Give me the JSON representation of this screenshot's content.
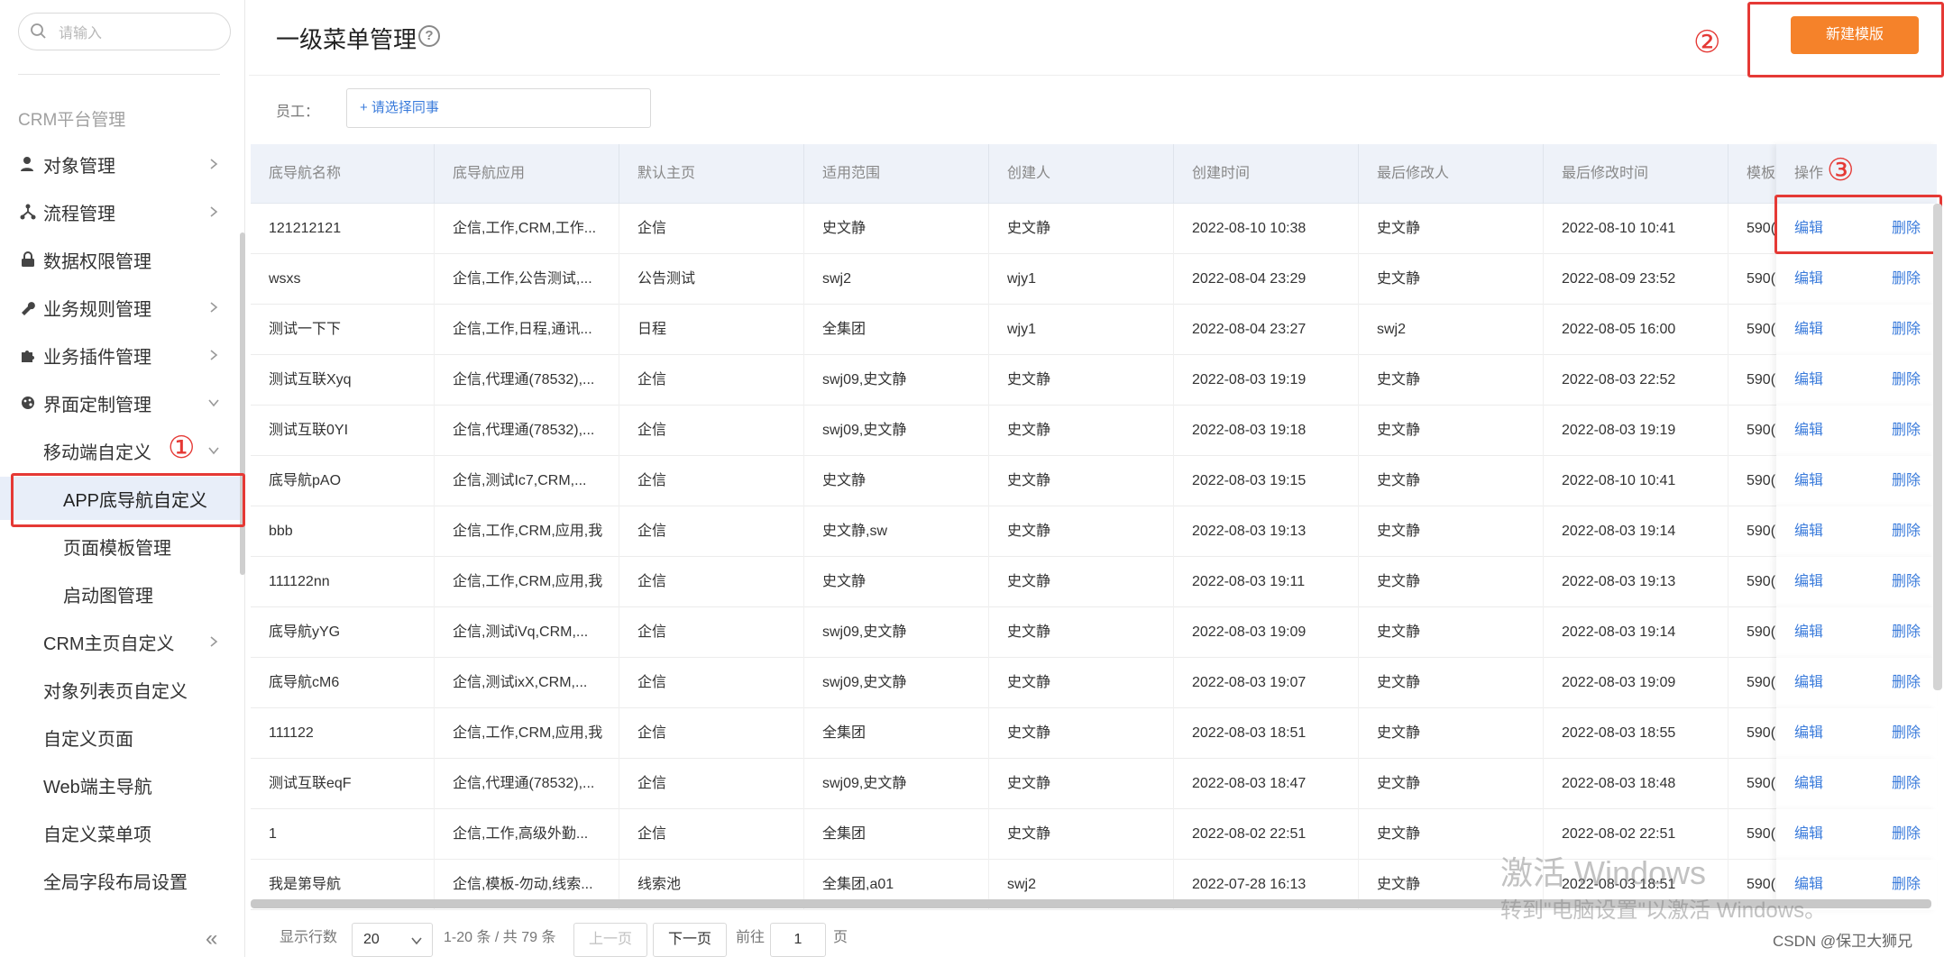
{
  "sidebar": {
    "search_placeholder": "请输入",
    "group_label": "CRM平台管理",
    "items": [
      {
        "label": "对象管理",
        "icon": "user-icon"
      },
      {
        "label": "流程管理",
        "icon": "flow-icon"
      },
      {
        "label": "数据权限管理",
        "icon": "lock-icon"
      },
      {
        "label": "业务规则管理",
        "icon": "wrench-icon"
      },
      {
        "label": "业务插件管理",
        "icon": "puzzle-icon"
      },
      {
        "label": "界面定制管理",
        "icon": "palette-icon"
      }
    ],
    "mobile_custom": "移动端自定义",
    "sub_items": [
      "APP底导航自定义",
      "页面模板管理",
      "启动图管理"
    ],
    "more_items": [
      "CRM主页自定义",
      "对象列表页自定义",
      "自定义页面",
      "Web端主导航",
      "自定义菜单项",
      "全局字段布局设置"
    ],
    "collapse": "«"
  },
  "annotations": {
    "one": "①",
    "two": "②",
    "three": "③"
  },
  "header": {
    "title": "一级菜单管理",
    "help": "?",
    "new_button": "新建模版"
  },
  "filter": {
    "label": "员工：",
    "input": "+ 请选择同事"
  },
  "table": {
    "columns": [
      "底导航名称",
      "底导航应用",
      "默认主页",
      "适用范围",
      "创建人",
      "创建时间",
      "最后修改人",
      "最后修改时间",
      "模板",
      "操作"
    ],
    "edit": "编辑",
    "delete": "删除",
    "rows": [
      [
        "121212121",
        "企信,工作,CRM,工作...",
        "企信",
        "史文静",
        "史文静",
        "2022-08-10 10:38",
        "史文静",
        "2022-08-10 10:41",
        "590("
      ],
      [
        "wsxs",
        "企信,工作,公告测试,...",
        "公告测试",
        "swj2",
        "wjy1",
        "2022-08-04 23:29",
        "史文静",
        "2022-08-09 23:52",
        "590("
      ],
      [
        "测试一下下",
        "企信,工作,日程,通讯...",
        "日程",
        "全集团",
        "wjy1",
        "2022-08-04 23:27",
        "swj2",
        "2022-08-05 16:00",
        "590("
      ],
      [
        "测试互联Xyq",
        "企信,代理通(78532),...",
        "企信",
        "swj09,史文静",
        "史文静",
        "2022-08-03 19:19",
        "史文静",
        "2022-08-03 22:52",
        "590("
      ],
      [
        "测试互联0YI",
        "企信,代理通(78532),...",
        "企信",
        "swj09,史文静",
        "史文静",
        "2022-08-03 19:18",
        "史文静",
        "2022-08-03 19:19",
        "590("
      ],
      [
        "底导航pAO",
        "企信,测试Ic7,CRM,...",
        "企信",
        "史文静",
        "史文静",
        "2022-08-03 19:15",
        "史文静",
        "2022-08-10 10:41",
        "590("
      ],
      [
        "bbb",
        "企信,工作,CRM,应用,我",
        "企信",
        "史文静,sw",
        "史文静",
        "2022-08-03 19:13",
        "史文静",
        "2022-08-03 19:14",
        "590("
      ],
      [
        "111122nn",
        "企信,工作,CRM,应用,我",
        "企信",
        "史文静",
        "史文静",
        "2022-08-03 19:11",
        "史文静",
        "2022-08-03 19:13",
        "590("
      ],
      [
        "底导航yYG",
        "企信,测试iVq,CRM,...",
        "企信",
        "swj09,史文静",
        "史文静",
        "2022-08-03 19:09",
        "史文静",
        "2022-08-03 19:14",
        "590("
      ],
      [
        "底导航cM6",
        "企信,测试ixX,CRM,...",
        "企信",
        "swj09,史文静",
        "史文静",
        "2022-08-03 19:07",
        "史文静",
        "2022-08-03 19:09",
        "590("
      ],
      [
        "111122",
        "企信,工作,CRM,应用,我",
        "企信",
        "全集团",
        "史文静",
        "2022-08-03 18:51",
        "史文静",
        "2022-08-03 18:55",
        "590("
      ],
      [
        "测试互联eqF",
        "企信,代理通(78532),...",
        "企信",
        "swj09,史文静",
        "史文静",
        "2022-08-03 18:47",
        "史文静",
        "2022-08-03 18:48",
        "590("
      ],
      [
        "1",
        "企信,工作,高级外勤...",
        "企信",
        "全集团",
        "史文静",
        "2022-08-02 22:51",
        "史文静",
        "2022-08-02 22:51",
        "590("
      ],
      [
        "我是第导航",
        "企信,模板-勿动,线索...",
        "线索池",
        "全集团,a01",
        "swj2",
        "2022-07-28 16:13",
        "史文静",
        "2022-08-03 18:51",
        "590("
      ]
    ]
  },
  "pager": {
    "rows_label": "显示行数",
    "rows_value": "20",
    "summary": "1-20 条 / 共 79 条",
    "prev": "上一页",
    "next": "下一页",
    "goto": "前往",
    "page": "1",
    "page_unit": "页"
  },
  "watermark": {
    "line1": "激活 Windows",
    "line2": "转到\"电脑设置\"以激活 Windows。"
  },
  "credit": "CSDN @保卫大狮兄",
  "colors": {
    "accent": "#f5822a",
    "link": "#3a7bdb",
    "annotation": "#e53935"
  }
}
